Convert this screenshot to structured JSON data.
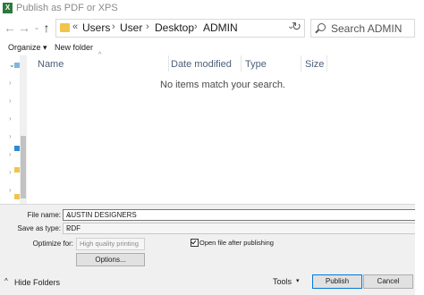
{
  "window": {
    "title": "Publish as PDF or XPS",
    "app_icon": "X"
  },
  "nav": {
    "back_icon": "back-arrow-icon",
    "forward_icon": "forward-arrow-icon",
    "recent_icon": "chevron-down-icon",
    "up_icon": "up-arrow-icon",
    "address_prefix": "«",
    "breadcrumbs": [
      "Users",
      "User",
      "Desktop",
      "ADMIN"
    ],
    "breadcrumb_separator": "›",
    "refresh_icon": "refresh-icon",
    "search_placeholder": "Search ADMIN"
  },
  "toolbar": {
    "organize_label": "Organize ▾",
    "new_folder_label": "New folder"
  },
  "file_list": {
    "columns": [
      "Name",
      "Date modified",
      "Type",
      "Size"
    ],
    "empty_message": "No items match your search."
  },
  "form": {
    "file_name_label": "File name:",
    "file_name_value": "AUSTIN DESIGNERS",
    "save_as_type_label": "Save as type:",
    "save_as_type_value": "PDF",
    "optimize_for_label": "Optimize for:",
    "optimize_value": "High quality printing",
    "open_after_label": "Open file after publishing",
    "open_after_checked": true,
    "options_label": "Options..."
  },
  "footer": {
    "hide_folders_label": "Hide Folders",
    "tools_label": "Tools",
    "publish_label": "Publish",
    "cancel_label": "Cancel"
  }
}
